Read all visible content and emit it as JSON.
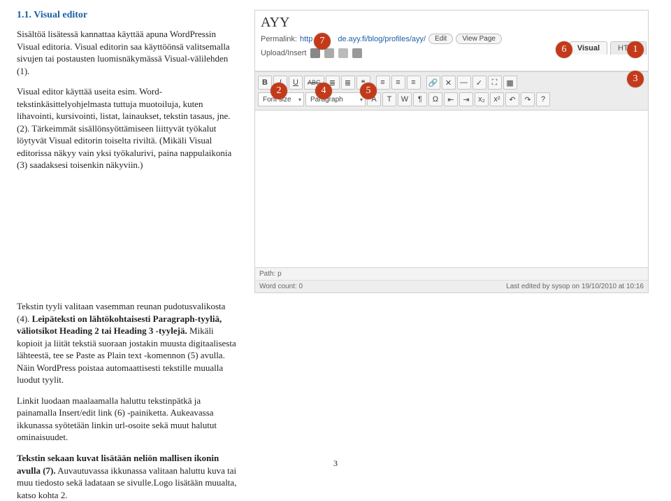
{
  "title": "1.1. Visual editor",
  "paragraphs": {
    "p1": "Sisältöä lisätessä kannattaa käyttää apuna WordPressin Visual editoria. Visual editorin saa käyttöönsä valitsemalla sivujen tai postausten luomisnäkymässä Visual-välilehden (1).",
    "p2": "Visual editor käyttää useita esim. Word-tekstinkäsittelyohjelmasta tuttuja muotoiluja, kuten lihavointi, kursivointi, listat, lainaukset, tekstin tasaus, jne. (2). Tärkeimmät sisällönsyöttämiseen liittyvät työkalut löytyvät Visual editorin toiselta riviltä. (Mikäli Visual editorissa näkyy vain yksi työkalurivi, paina nappulaikonia (3) saadaksesi toisenkin näkyviin.)",
    "p3_a": "Tekstin tyyli valitaan vasemman reunan pudotusvalikosta (4). ",
    "p3_b": "Leipäteksti on lähtökohtaisesti Paragraph-tyyliä, väliotsikot Heading 2 tai Heading 3 -tyylejä.",
    "p3_c": " Mikäli kopioit ja liität tekstiä suoraan jostakin muusta digitaalisesta lähteestä, tee se Paste as Plain text -komennon (5) avulla. Näin WordPress poistaa automaattisesti tekstille muualla luodut tyylit.",
    "p4": "Linkit luodaan maalaamalla haluttu tekstinpätkä ja painamalla Insert/edit link (6) -painiketta. Aukeavassa ikkunassa syötetään linkin url-osoite sekä muut halutut ominaisuudet.",
    "p5_a": "Tekstin sekaan kuvat lisätään neliön mallisen ikonin avulla (7).",
    "p5_b": " Auvautuvassa ikkunassa valitaan haluttu kuva tai muu tiedosto sekä ladataan se sivulle.Logo lisätään muualta, katso kohta 2."
  },
  "editor": {
    "page_title": "AYY",
    "permalink_label": "Permalink:",
    "permalink_prefix": "http",
    "permalink_suffix": "de.ayy.fi/blog/profiles/ayy/",
    "edit_btn": "Edit",
    "view_btn": "View Page",
    "upload_label": "Upload/Insert",
    "tab_visual": "Visual",
    "tab_html": "HTML",
    "row1": {
      "b": "B",
      "i": "I",
      "u": "U",
      "abe": "ABC",
      "ul": "≣",
      "ol": "≣",
      "quote": "❝",
      "al": "≡",
      "ac": "≡",
      "ar": "≡",
      "link": "🔗",
      "unlink": "✕",
      "more": "—",
      "spell": "✓",
      "full": "⛶",
      "sink": "▦"
    },
    "row2": {
      "fontsize_label": "Font size",
      "para_label": "Paragraph"
    },
    "path_label": "Path: p",
    "wordcount": "Word count: 0",
    "lastedit": "Last edited by sysop on 19/10/2010 at 10:16"
  },
  "callouts": {
    "c1": "1",
    "c2": "2",
    "c3": "3",
    "c4": "4",
    "c5": "5",
    "c6": "6",
    "c7": "7"
  },
  "page_number": "3"
}
